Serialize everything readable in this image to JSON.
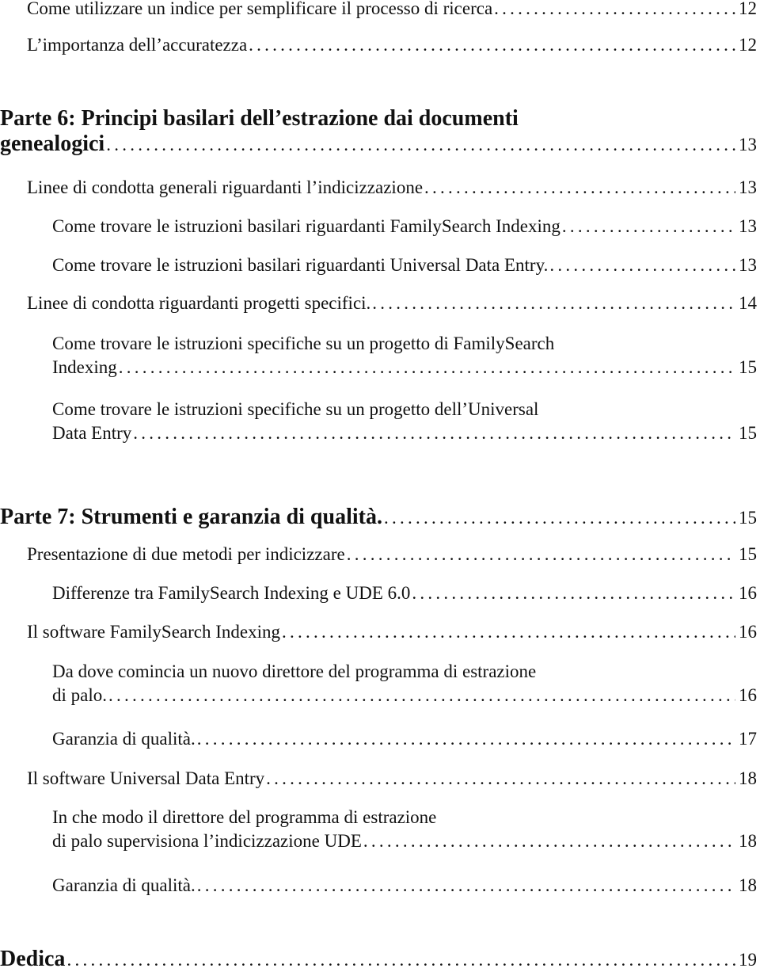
{
  "toc": [
    {
      "level": 1,
      "lines": [
        "Come utilizzare un indice per semplificare il processo di ricerca"
      ],
      "page": "12"
    },
    {
      "level": 1,
      "lines": [
        "L’importanza dell’accuratezza"
      ],
      "page": "12"
    },
    {
      "level": 0,
      "lines": [
        "Parte 6: Principi basilari dell’estrazione dai documenti",
        "genealogici"
      ],
      "page": "13"
    },
    {
      "level": 1,
      "lines": [
        "Linee di condotta generali riguardanti l’indicizzazione"
      ],
      "page": "13"
    },
    {
      "level": 2,
      "lines": [
        "Come trovare le istruzioni basilari riguardanti FamilySearch Indexing"
      ],
      "page": "13"
    },
    {
      "level": 2,
      "lines": [
        "Come trovare le istruzioni basilari riguardanti Universal Data Entry."
      ],
      "page": "13"
    },
    {
      "level": 1,
      "lines": [
        "Linee di condotta riguardanti progetti specifici."
      ],
      "page": "14"
    },
    {
      "level": 2,
      "lines": [
        "Come trovare le istruzioni specifiche su un progetto di FamilySearch",
        "Indexing"
      ],
      "page": "15"
    },
    {
      "level": 2,
      "lines": [
        "Come trovare le istruzioni specifiche su un progetto dell’Universal",
        "Data Entry"
      ],
      "page": "15"
    },
    {
      "level": 0,
      "lines": [
        "Parte 7: Strumenti e garanzia di qualità."
      ],
      "page": "15"
    },
    {
      "level": 1,
      "lines": [
        "Presentazione di due metodi per indicizzare"
      ],
      "page": "15"
    },
    {
      "level": 2,
      "lines": [
        "Differenze tra FamilySearch Indexing e UDE 6.0"
      ],
      "page": "16"
    },
    {
      "level": 1,
      "lines": [
        "Il software FamilySearch Indexing"
      ],
      "page": "16"
    },
    {
      "level": 2,
      "lines": [
        "Da dove comincia un nuovo direttore del programma di estrazione",
        "di palo."
      ],
      "page": "16"
    },
    {
      "level": 2,
      "lines": [
        "Garanzia di qualità."
      ],
      "page": "17"
    },
    {
      "level": 1,
      "lines": [
        "Il software Universal Data Entry"
      ],
      "page": "18"
    },
    {
      "level": 2,
      "lines": [
        "In che modo il direttore del programma di estrazione",
        "di palo supervisiona l’indicizzazione UDE"
      ],
      "page": "18"
    },
    {
      "level": 2,
      "lines": [
        "Garanzia di qualità."
      ],
      "page": "18"
    },
    {
      "level": 0,
      "lines": [
        "Dedica"
      ],
      "page": "19"
    }
  ]
}
